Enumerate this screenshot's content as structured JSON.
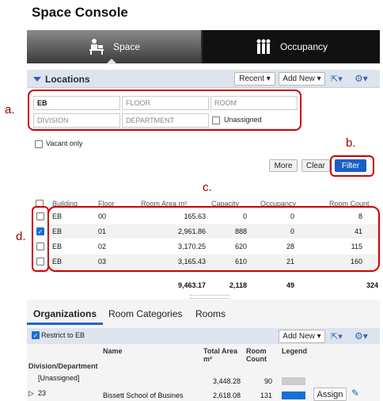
{
  "page": {
    "title": "Space Console"
  },
  "tabs": {
    "space": "Space",
    "occupancy": "Occupancy"
  },
  "locations": {
    "title": "Locations",
    "recent": "Recent",
    "add_new": "Add New",
    "building_value": "EB",
    "floor_placeholder": "FLOOR",
    "room_placeholder": "ROOM",
    "division_placeholder": "DIVISION",
    "department_placeholder": "DEPARTMENT",
    "unassigned": "Unassigned",
    "vacant_only": "Vacant only",
    "more": "More",
    "clear": "Clear",
    "filter": "Filter"
  },
  "annotations": {
    "a": "a.",
    "b": "b.",
    "c": "c.",
    "d": "d."
  },
  "table": {
    "headers": [
      "Building",
      "Floor",
      "Room Area m²",
      "Capacity",
      "Occupancy",
      "Room Count"
    ],
    "rows": [
      {
        "building": "EB",
        "floor": "00",
        "area": "165.63",
        "capacity": "0",
        "occupancy": "0",
        "count": "8",
        "checked": false
      },
      {
        "building": "EB",
        "floor": "01",
        "area": "2,961.86",
        "capacity": "888",
        "occupancy": "0",
        "count": "41",
        "checked": true
      },
      {
        "building": "EB",
        "floor": "02",
        "area": "3,170.25",
        "capacity": "620",
        "occupancy": "28",
        "count": "115",
        "checked": false
      },
      {
        "building": "EB",
        "floor": "03",
        "area": "3,165.43",
        "capacity": "610",
        "occupancy": "21",
        "count": "160",
        "checked": false
      }
    ],
    "totals": {
      "area": "9,463.17",
      "capacity": "2,118",
      "occupancy": "49",
      "count": "324"
    }
  },
  "org": {
    "tabs": [
      "Organizations",
      "Room Categories",
      "Rooms"
    ],
    "restrict": "Restrict to EB",
    "add_new": "Add New",
    "col_division": "Division/Department",
    "col_name": "Name",
    "col_area": "Total Area m²",
    "col_room": "Room Count",
    "col_legend": "Legend",
    "rows": [
      {
        "division": "[Unassigned]",
        "name": "",
        "area": "3,448.28",
        "count": "90",
        "legend_color": "#cccccc"
      },
      {
        "division": "23",
        "name": "Bissett School of Busines",
        "area": "2,618.08",
        "count": "131",
        "legend_color": "#1a6fd6"
      }
    ],
    "assign": "Assign"
  },
  "colors": {
    "accent": "#2563c9",
    "annotation_red": "#c00000",
    "filter_button": "#1a5fc8"
  }
}
